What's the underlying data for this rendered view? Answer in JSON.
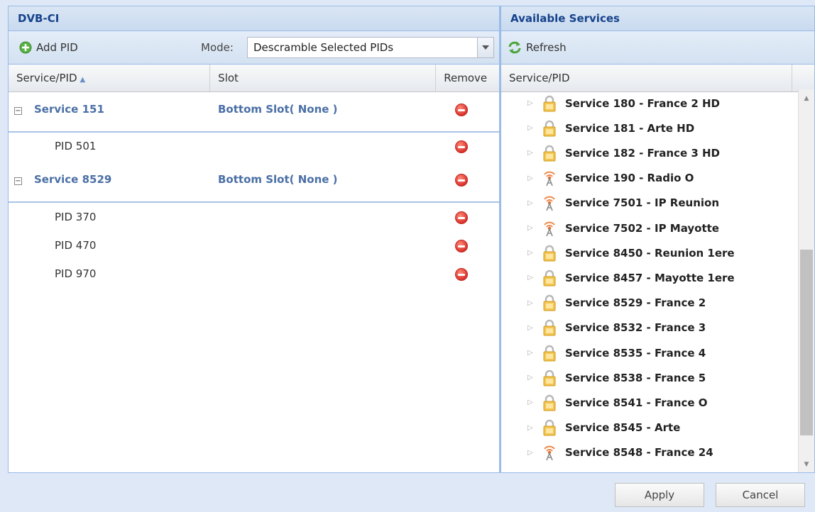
{
  "left": {
    "title": "DVB-CI",
    "add_pid": "Add PID",
    "mode_label": "Mode:",
    "mode_value": "Descramble Selected PIDs",
    "columns": {
      "service": "Service/PID",
      "slot": "Slot",
      "remove": "Remove"
    },
    "groups": [
      {
        "service": "Service 151",
        "slot": "Bottom Slot( None )",
        "pids": [
          "PID 501"
        ]
      },
      {
        "service": "Service 8529",
        "slot": "Bottom Slot( None )",
        "pids": [
          "PID 370",
          "PID 470",
          "PID 970"
        ]
      }
    ]
  },
  "right": {
    "title": "Available Services",
    "refresh": "Refresh",
    "column": "Service/PID",
    "services": [
      {
        "label": "Service 180 - France 2 HD",
        "icon": "lock-icon"
      },
      {
        "label": "Service 181 - Arte HD",
        "icon": "lock-icon"
      },
      {
        "label": "Service 182 - France 3 HD",
        "icon": "lock-icon"
      },
      {
        "label": "Service 190 - Radio O",
        "icon": "radio-tower-icon"
      },
      {
        "label": "Service 7501 - IP Reunion",
        "icon": "radio-tower-icon"
      },
      {
        "label": "Service 7502 - IP Mayotte",
        "icon": "radio-tower-icon"
      },
      {
        "label": "Service 8450 - Reunion 1ere",
        "icon": "lock-icon"
      },
      {
        "label": "Service 8457 - Mayotte 1ere",
        "icon": "lock-icon"
      },
      {
        "label": "Service 8529 - France 2",
        "icon": "lock-icon"
      },
      {
        "label": "Service 8532 - France 3",
        "icon": "lock-icon"
      },
      {
        "label": "Service 8535 - France 4",
        "icon": "lock-icon"
      },
      {
        "label": "Service 8538 - France 5",
        "icon": "lock-icon"
      },
      {
        "label": "Service 8541 - France O",
        "icon": "lock-icon"
      },
      {
        "label": "Service 8545 - Arte",
        "icon": "lock-icon"
      },
      {
        "label": "Service 8548 - France 24",
        "icon": "radio-tower-icon"
      }
    ]
  },
  "footer": {
    "apply": "Apply",
    "cancel": "Cancel"
  }
}
